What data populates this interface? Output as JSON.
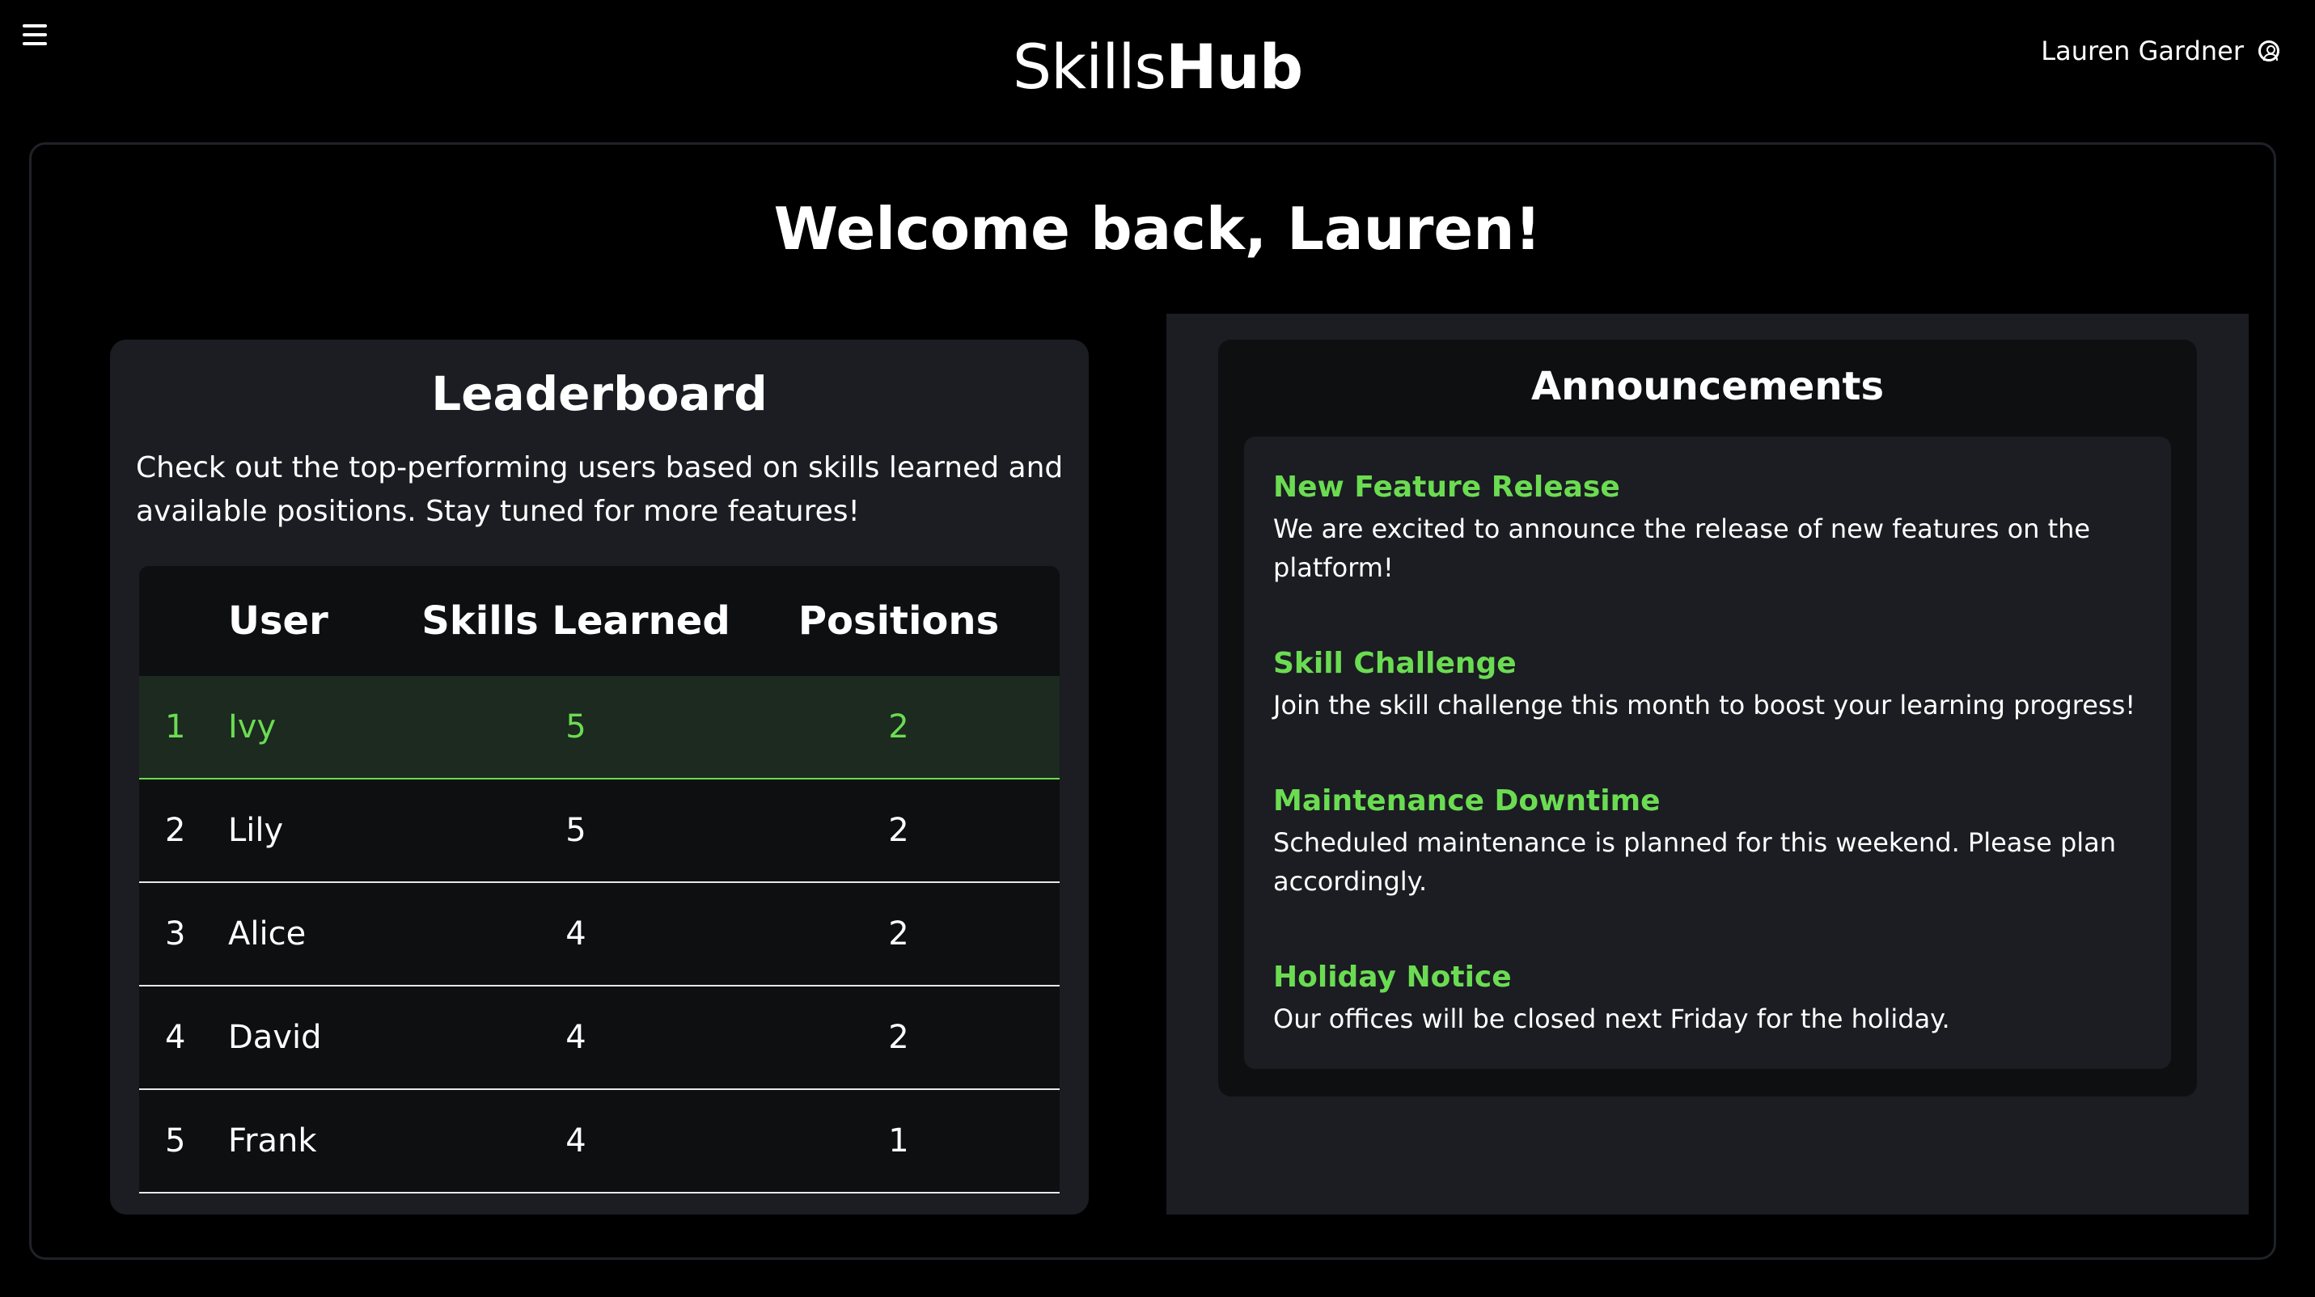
{
  "header": {
    "brand_part1": "Skills",
    "brand_part2": "Hub",
    "user_name": "Lauren Gardner",
    "menu_icon": "hamburger-menu-icon",
    "user_icon": "user-circle-icon"
  },
  "welcome": "Welcome back, Lauren!",
  "leaderboard": {
    "title": "Leaderboard",
    "description": "Check out the top-performing users based on skills learned and available positions. Stay tuned for more features!",
    "columns": [
      "",
      "User",
      "Skills Learned",
      "Positions"
    ],
    "rows": [
      {
        "rank": "1",
        "user": "Ivy",
        "skills": "5",
        "positions": "2"
      },
      {
        "rank": "2",
        "user": "Lily",
        "skills": "5",
        "positions": "2"
      },
      {
        "rank": "3",
        "user": "Alice",
        "skills": "4",
        "positions": "2"
      },
      {
        "rank": "4",
        "user": "David",
        "skills": "4",
        "positions": "2"
      },
      {
        "rank": "5",
        "user": "Frank",
        "skills": "4",
        "positions": "1"
      }
    ]
  },
  "announcements": {
    "title": "Announcements",
    "items": [
      {
        "title": "New Feature Release",
        "desc": "We are excited to announce the release of new features on the platform!"
      },
      {
        "title": "Skill Challenge",
        "desc": "Join the skill challenge this month to boost your learning progress!"
      },
      {
        "title": "Maintenance Downtime",
        "desc": "Scheduled maintenance is planned for this weekend. Please plan accordingly."
      },
      {
        "title": "Holiday Notice",
        "desc": "Our offices will be closed next Friday for the holiday."
      }
    ]
  },
  "colors": {
    "accent": "#6bdc52",
    "background": "#000000",
    "card": "#1b1d22",
    "table": "#0d0f11"
  }
}
